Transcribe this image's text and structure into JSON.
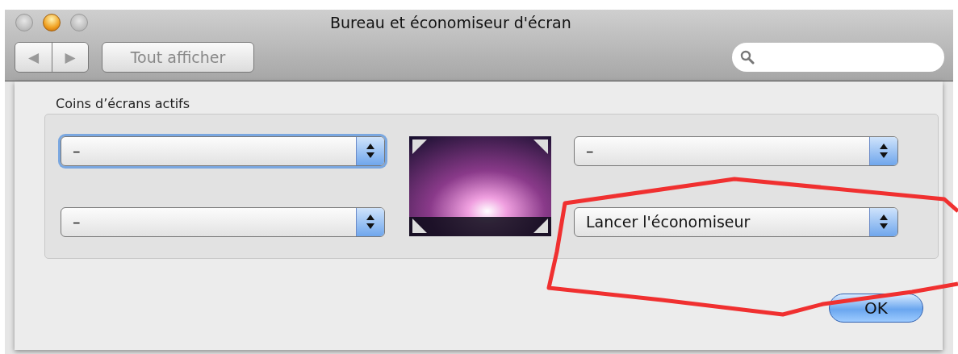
{
  "window": {
    "title": "Bureau et économiseur d'écran"
  },
  "toolbar": {
    "nav": [
      "◀",
      "▶"
    ],
    "show_all": "Tout afficher"
  },
  "sheet": {
    "group_label": "Coins d’écrans actifs",
    "left_corners": [
      {
        "value": "–",
        "focused": true
      },
      {
        "value": "–",
        "focused": false
      }
    ],
    "right_corners": [
      {
        "value": "–",
        "focused": false
      },
      {
        "value": "Lancer l'économiseur",
        "focused": false
      }
    ],
    "ok": "OK"
  }
}
